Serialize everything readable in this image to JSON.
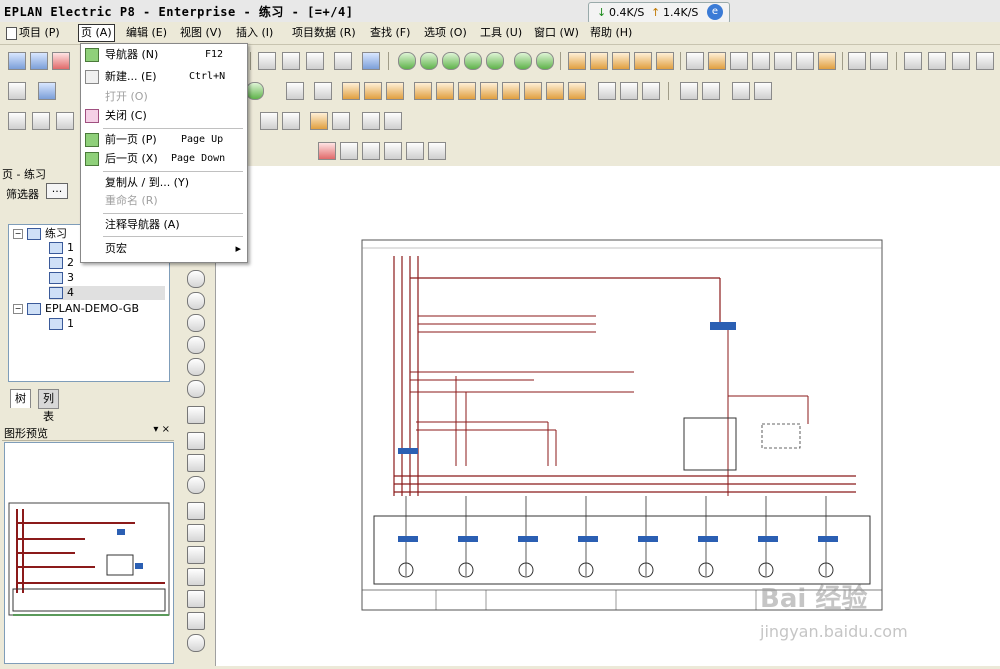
{
  "window": {
    "title": "EPLAN Electric P8 - Enterprise - 练习 - [=+/4]",
    "net_down": "0.4K/S",
    "net_up": "1.4K/S"
  },
  "menubar": {
    "items": [
      "项目 (P)",
      "页 (A)",
      "编辑 (E)",
      "视图 (V)",
      "插入 (I)",
      "项目数据 (R)",
      "查找 (F)",
      "选项 (O)",
      "工具 (U)",
      "窗口 (W)",
      "帮助 (H)"
    ]
  },
  "page_menu": {
    "items": [
      {
        "label": "导航器 (N)",
        "shortcut": "F12",
        "disabled": false
      },
      {
        "label": "新建... (E)",
        "shortcut": "Ctrl+N",
        "disabled": false
      },
      {
        "label": "打开 (O)",
        "shortcut": "",
        "disabled": true
      },
      {
        "label": "关闭 (C)",
        "shortcut": "",
        "disabled": false
      },
      {
        "label": "前一页 (P)",
        "shortcut": "Page Up",
        "disabled": false
      },
      {
        "label": "后一页 (X)",
        "shortcut": "Page Down",
        "disabled": false
      },
      {
        "label": "复制从 / 到... (Y)",
        "shortcut": "",
        "disabled": false
      },
      {
        "label": "重命名 (R)",
        "shortcut": "",
        "disabled": true
      },
      {
        "label": "注释导航器 (A)",
        "shortcut": "",
        "disabled": false
      },
      {
        "label": "页宏",
        "shortcut": "",
        "disabled": false
      }
    ]
  },
  "left_panel": {
    "title": "页 - 练习",
    "filter_label": "筛选器",
    "filter_button": "...",
    "tree": {
      "project1": "练习",
      "pages1": [
        "1",
        "2",
        "3",
        "4"
      ],
      "project2": "EPLAN-DEMO-GB",
      "pages2": [
        "1"
      ]
    },
    "tabs": [
      "树",
      "列表"
    ],
    "preview_title": "图形预览",
    "preview_controls": "▾ ×"
  },
  "icons": {
    "menu_icon": "page-icon",
    "dropdown_icon": "green-page-icon"
  },
  "watermark": {
    "line1": "Bai 经验",
    "line2": "jingyan.baidu.com"
  }
}
